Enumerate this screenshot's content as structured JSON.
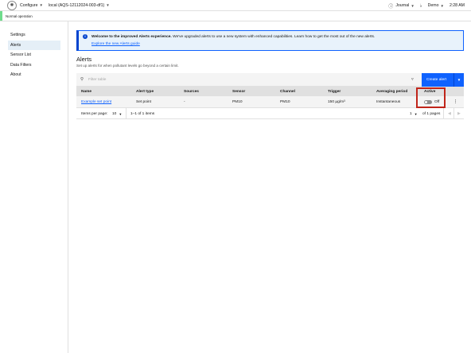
{
  "header": {
    "menu_configure": "Configure",
    "device": "local (AQS-12112024-003-df1)",
    "journal": "Journal",
    "user": "Demo",
    "time": "2:28 AM"
  },
  "status": {
    "text": "Normal operation",
    "color": "#6fdc8c"
  },
  "sidebar": {
    "items": [
      {
        "label": "Settings"
      },
      {
        "label": "Alerts"
      },
      {
        "label": "Sensor List"
      },
      {
        "label": "Data Filters"
      },
      {
        "label": "About"
      }
    ]
  },
  "banner": {
    "title": "Welcome to the improved Alerts experience.",
    "message": "We've upgraded alerts to use a new system with enhanced capabilities. Learn how to get the most out of the new alerts.",
    "link": "Explore the new Alerts guide"
  },
  "page": {
    "title": "Alerts",
    "subtitle": "Set up alerts for when pollutant levels go beyond a certain limit."
  },
  "toolbar": {
    "filter_placeholder": "Filter table",
    "create_button": "Create alert"
  },
  "table": {
    "columns": [
      "Name",
      "Alert type",
      "Sources",
      "Sensor",
      "Channel",
      "Trigger",
      "Averaging period",
      "Active"
    ],
    "rows": [
      {
        "name": "Example set point",
        "alert_type": "Set point",
        "sources": "-",
        "sensor": "PM10",
        "channel": "PM10",
        "trigger": "150 µg/m³",
        "averaging_period": "Instantaneous",
        "active": "Off"
      }
    ]
  },
  "pagination": {
    "items_per_page_label": "Items per page:",
    "items_per_page": "10",
    "range": "1–1 of 1 items",
    "page": "1",
    "of_pages": "of 1 pages"
  },
  "colors": {
    "accent": "#0f62fe",
    "highlight": "#c0251a"
  }
}
